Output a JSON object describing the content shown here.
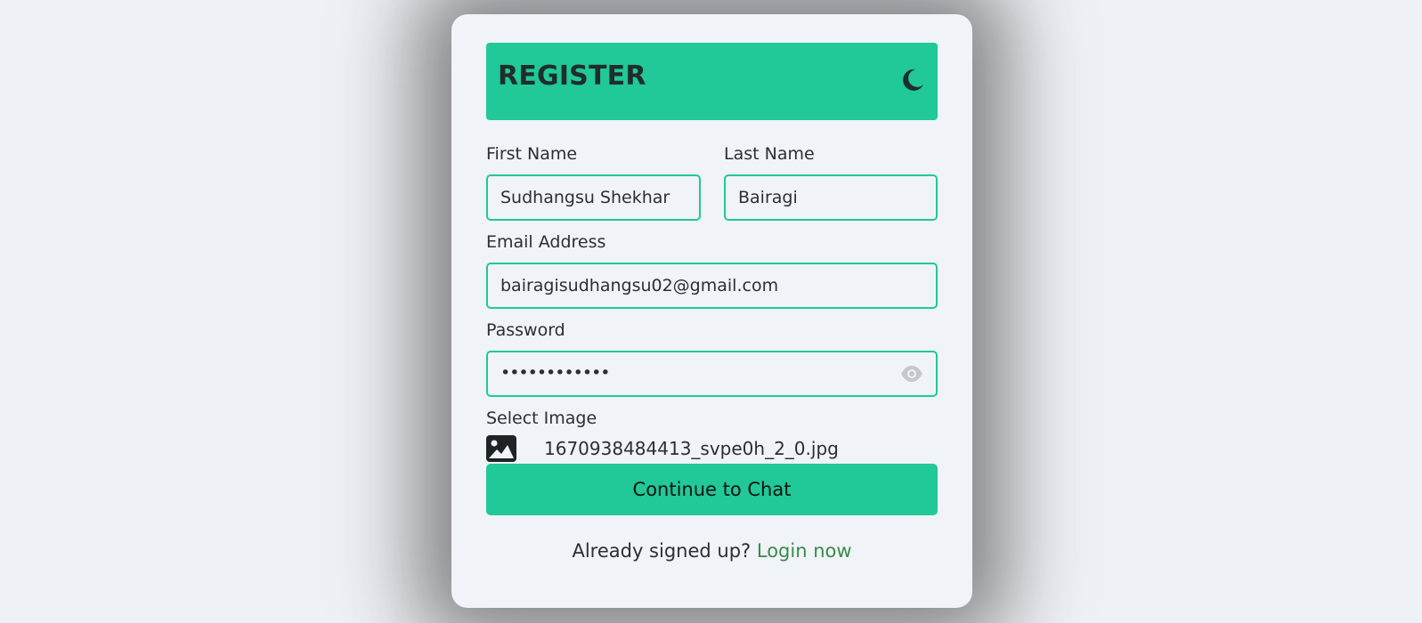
{
  "header": {
    "title": "REGISTER",
    "theme_icon": "moon-icon"
  },
  "form": {
    "first_name": {
      "label": "First Name",
      "value": "Sudhangsu Shekhar"
    },
    "last_name": {
      "label": "Last Name",
      "value": "Bairagi"
    },
    "email": {
      "label": "Email Address",
      "value": "bairagisudhangsu02@gmail.com"
    },
    "password": {
      "label": "Password",
      "masked_value": "••••••••••••",
      "toggle_icon": "eye-icon"
    },
    "image": {
      "label": "Select Image",
      "icon": "image-icon",
      "file_name": "1670938484413_svpe0h_2_0.jpg"
    },
    "submit_label": "Continue to Chat"
  },
  "footer": {
    "prompt": "Already signed up?",
    "link_label": "Login now"
  },
  "colors": {
    "accent": "#20c997",
    "background": "#eef1f6",
    "card": "#f0f3f8",
    "link": "#3c8a4a",
    "text": "#2b2f33"
  }
}
